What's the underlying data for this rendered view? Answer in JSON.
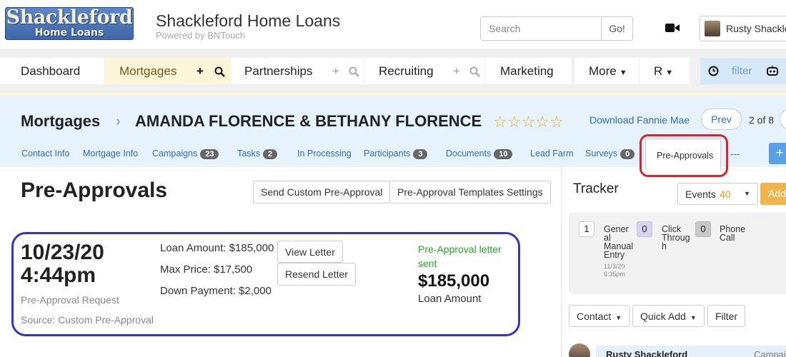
{
  "header": {
    "logo_line1": "Shackleford",
    "logo_line2": "Home Loans",
    "title": "Shackleford Home Loans",
    "powered_by": "Powered by BNTouch",
    "search_placeholder": "Search",
    "go_label": "Go!",
    "user_name": "Rusty Shackleford"
  },
  "nav": {
    "dashboard": "Dashboard",
    "mortgages": "Mortgages",
    "partnerships": "Partnerships",
    "recruiting": "Recruiting",
    "marketing": "Marketing",
    "more": "More",
    "r": "R",
    "filter": "filter",
    "plus": "+",
    "search_glyph": "🔍"
  },
  "breadcrumb": {
    "root": "Mortgages",
    "separator": "›",
    "record": "AMANDA FLORENCE & BETHANY FLORENCE",
    "rating": 0,
    "rating_max": 5
  },
  "record_nav": {
    "download_link": "Download Fannie Mae",
    "prev_label": "Prev",
    "position": "2 of 8"
  },
  "subtabs": [
    {
      "label": "Contact Info",
      "count": ""
    },
    {
      "label": "Mortgage Info",
      "count": ""
    },
    {
      "label": "Campaigns",
      "count": "23"
    },
    {
      "label": "Tasks",
      "count": "2"
    },
    {
      "label": "In Processing",
      "count": ""
    },
    {
      "label": "Participants",
      "count": "3"
    },
    {
      "label": "Documents",
      "count": "10"
    },
    {
      "label": "Lead Farm",
      "count": ""
    },
    {
      "label": "Surveys",
      "count": "0"
    }
  ],
  "active_subtab": "Pre-Approvals",
  "subtab_more": "---",
  "main": {
    "title": "Pre-Approvals",
    "send_custom_label": "Send Custom Pre-Approval",
    "templates_label": "Pre-Approval Templates Settings"
  },
  "preapproval": {
    "date": "10/23/20",
    "time": "4:44pm",
    "type": "Pre-Approval Request",
    "source": "Source: Custom Pre-Approval",
    "loan_amount": "Loan Amount: $185,000",
    "max_price": "Max Price: $17,500",
    "down_payment": "Down Payment: $2,000",
    "view_letter": "View Letter",
    "resend_letter": "Resend Letter",
    "status": "Pre-Approval letter sent",
    "amount": "$185,000",
    "amount_label": "Loan Amount"
  },
  "tracker": {
    "title": "Tracker",
    "events_label": "Events",
    "events_count": "40",
    "add_label": "Add",
    "items": [
      {
        "count": "1",
        "label": "Gener al Manual Entry",
        "date": "11/3/20 6:35pm"
      },
      {
        "count": "0",
        "label": "Click Throug h"
      },
      {
        "count": "0",
        "label": "Phone Call"
      }
    ],
    "contact_label": "Contact",
    "quick_add_label": "Quick Add",
    "filter_label": "Filter",
    "feed_name": "Rusty Shackleford",
    "feed_type": "Campaign"
  },
  "colors": {
    "accent_blue": "#2f6fb5",
    "active_tab_bg": "#fcf6d9",
    "subheader_bg": "#e6f2fc",
    "status_green": "#2aa32a",
    "star_gold": "#e8b12a",
    "highlight_red": "#d9232d",
    "highlight_navy": "#3333c4"
  }
}
